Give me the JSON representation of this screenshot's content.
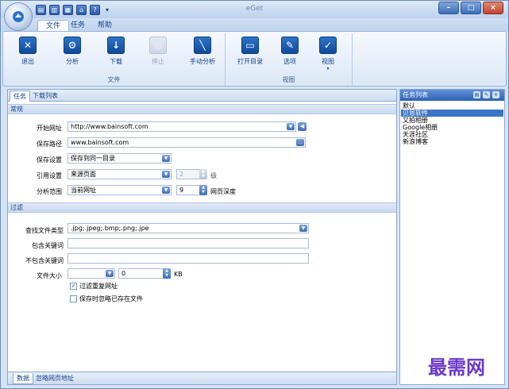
{
  "window": {
    "title": "eGet"
  },
  "quick_access": {
    "icons": [
      "folder-open-icon",
      "save-icon",
      "floppy-icon",
      "home-icon",
      "help-icon"
    ],
    "dropdown": "▾"
  },
  "menu": {
    "tabs": [
      {
        "label": "文件",
        "active": true
      },
      {
        "label": "任务"
      },
      {
        "label": "帮助"
      }
    ]
  },
  "ribbon": {
    "groups": [
      {
        "label": "文件",
        "buttons": [
          {
            "label": "退出",
            "icon": "exit-icon",
            "enabled": true
          },
          {
            "label": "分析",
            "icon": "gears-icon",
            "enabled": true
          },
          {
            "label": "下载",
            "icon": "download-icon",
            "enabled": true
          },
          {
            "label": "停止",
            "icon": "stop-icon",
            "enabled": false
          },
          {
            "label": "手动分析",
            "icon": "wrench-icon",
            "enabled": true
          }
        ]
      },
      {
        "label": "视图",
        "buttons": [
          {
            "label": "打开目录",
            "icon": "open-folder-icon",
            "enabled": true
          },
          {
            "label": "选项",
            "icon": "options-icon",
            "enabled": true
          },
          {
            "label": "视图",
            "icon": "view-icon",
            "enabled": true,
            "dropdown": "▾"
          }
        ]
      }
    ]
  },
  "panel_tabs": [
    {
      "label": "任务",
      "active": true
    },
    {
      "label": "下载列表"
    }
  ],
  "sections": {
    "general": {
      "title": "常规",
      "start_url": {
        "label": "开始网址",
        "value": "http://www.bainsoft.com"
      },
      "save_path": {
        "label": "保存路径",
        "value": "www.bainsoft.com"
      },
      "save_setting": {
        "label": "保存设置",
        "value": "保存到同一目录"
      },
      "ref_setting": {
        "label": "引用设置",
        "value": "来源页面",
        "level_value": "2",
        "level_unit": "级"
      },
      "analysis_range": {
        "label": "分析范围",
        "value": "当前网址",
        "depth_value": "9",
        "depth_unit": "网页深度"
      }
    },
    "filter": {
      "title": "过滤",
      "file_types": {
        "label": "查找文件类型",
        "value": ".jpg;.jpeg;.bmp;.png;.jpe"
      },
      "include_keyword": {
        "label": "包含关键词",
        "value": ""
      },
      "exclude_keyword": {
        "label": "不包含关键词",
        "value": ""
      },
      "file_size": {
        "label": "文件大小",
        "value": "0",
        "unit": "KB"
      },
      "filter_duplicate": {
        "label": "过滤重复网址",
        "checked": true
      },
      "skip_existing": {
        "label": "保存时忽略已存在文件",
        "checked": false
      }
    }
  },
  "bottom_tabs": [
    {
      "label": "数据",
      "active": true
    },
    {
      "label": "忽略网页地址"
    }
  ],
  "task_panel": {
    "title": "任务列表",
    "items": [
      {
        "label": "默认",
        "selected": false
      },
      {
        "label": "贝恩软件",
        "selected": true
      },
      {
        "label": "又拍相册",
        "selected": false
      },
      {
        "label": "Google相册",
        "selected": false
      },
      {
        "label": "天涯社区",
        "selected": false
      },
      {
        "label": "新浪博客",
        "selected": false
      }
    ]
  },
  "watermark": "最需网"
}
